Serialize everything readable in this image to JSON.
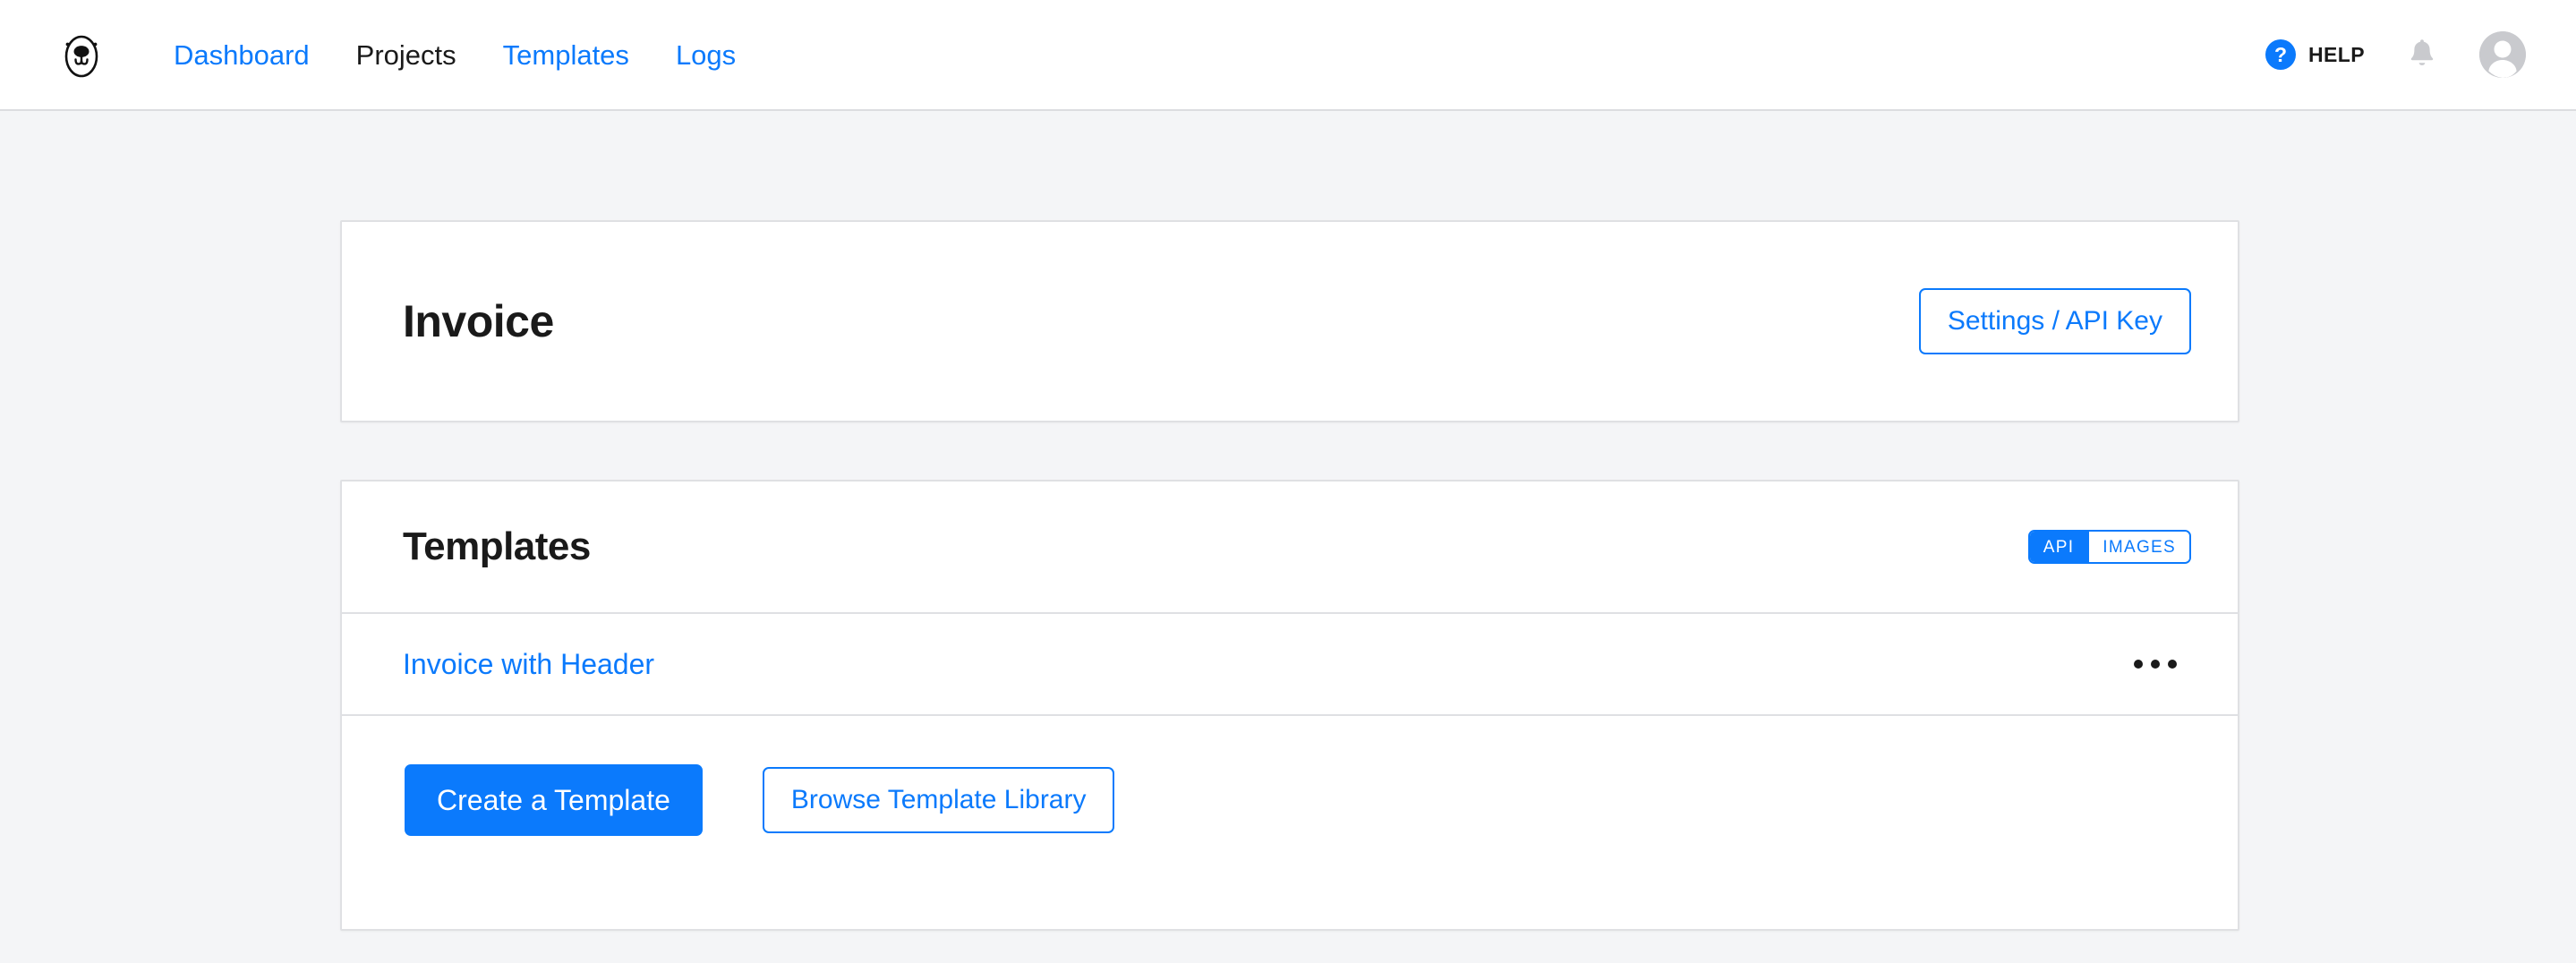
{
  "navbar": {
    "logo_name": "apitemplate-egg-logo",
    "links": [
      {
        "label": "Dashboard",
        "active": false
      },
      {
        "label": "Projects",
        "active": true
      },
      {
        "label": "Templates",
        "active": false
      },
      {
        "label": "Logs",
        "active": false
      }
    ],
    "help": {
      "badge": "?",
      "label": "HELP"
    },
    "notifications_icon": "bell-icon",
    "avatar_icon": "user-avatar-icon"
  },
  "invoice_card": {
    "title": "Invoice",
    "settings_button": "Settings / API Key"
  },
  "templates_card": {
    "title": "Templates",
    "toggle": {
      "options": [
        "API",
        "IMAGES"
      ],
      "selected": "API"
    },
    "rows": [
      {
        "name": "Invoice with Header",
        "menu_icon": "kebab-menu-icon"
      }
    ],
    "actions": {
      "create": "Create a Template",
      "browse": "Browse Template Library"
    }
  },
  "colors": {
    "accent": "#0b7afc",
    "page_background": "#f4f5f7",
    "card_background": "#ffffff",
    "border": "#dfe0e3",
    "text": "#1a1a1a"
  }
}
